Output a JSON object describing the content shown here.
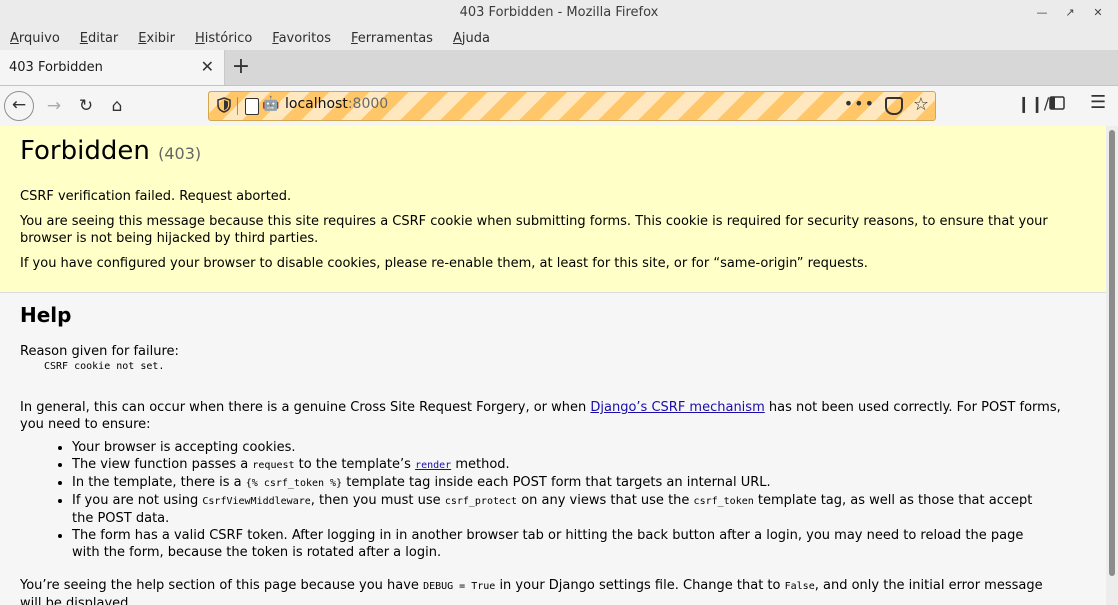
{
  "window": {
    "title": "403 Forbidden - Mozilla Firefox"
  },
  "menu": [
    "Arquivo",
    "Editar",
    "Exibir",
    "Histórico",
    "Favoritos",
    "Ferramentas",
    "Ajuda"
  ],
  "tab": {
    "title": "403 Forbidden"
  },
  "url": {
    "host": "localhost",
    "port": ":8000"
  },
  "page": {
    "title": "Forbidden",
    "code": "(403)",
    "p1": "CSRF verification failed. Request aborted.",
    "p2": "You are seeing this message because this site requires a CSRF cookie when submitting forms. This cookie is required for security reasons, to ensure that your browser is not being hijacked by third parties.",
    "p3": "If you have configured your browser to disable cookies, please re-enable them, at least for this site, or for “same-origin” requests.",
    "help_title": "Help",
    "reason_label": "Reason given for failure:",
    "reason": "CSRF cookie not set.",
    "general_pre": "In general, this can occur when there is a genuine Cross Site Request Forgery, or when ",
    "general_link": "Django’s CSRF mechanism",
    "general_post": " has not been used correctly. For POST forms, you need to ensure:",
    "b1": "Your browser is accepting cookies.",
    "b2_a": "The view function passes a ",
    "b2_code": "request",
    "b2_b": " to the template’s ",
    "b2_link": "render",
    "b2_c": " method.",
    "b3_a": "In the template, there is a ",
    "b3_code": "{% csrf_token %}",
    "b3_b": " template tag inside each POST form that targets an internal URL.",
    "b4_a": "If you are not using ",
    "b4_code1": "CsrfViewMiddleware",
    "b4_b": ", then you must use ",
    "b4_code2": "csrf_protect",
    "b4_c": " on any views that use the ",
    "b4_code3": "csrf_token",
    "b4_d": " template tag, as well as those that accept the POST data.",
    "b5": "The form has a valid CSRF token. After logging in in another browser tab or hitting the back button after a login, you may need to reload the page with the form, because the token is rotated after a login.",
    "debug_a": "You’re seeing the help section of this page because you have ",
    "debug_code1": "DEBUG = True",
    "debug_b": " in your Django settings file. Change that to ",
    "debug_code2": "False",
    "debug_c": ", and only the initial error message will be displayed."
  }
}
